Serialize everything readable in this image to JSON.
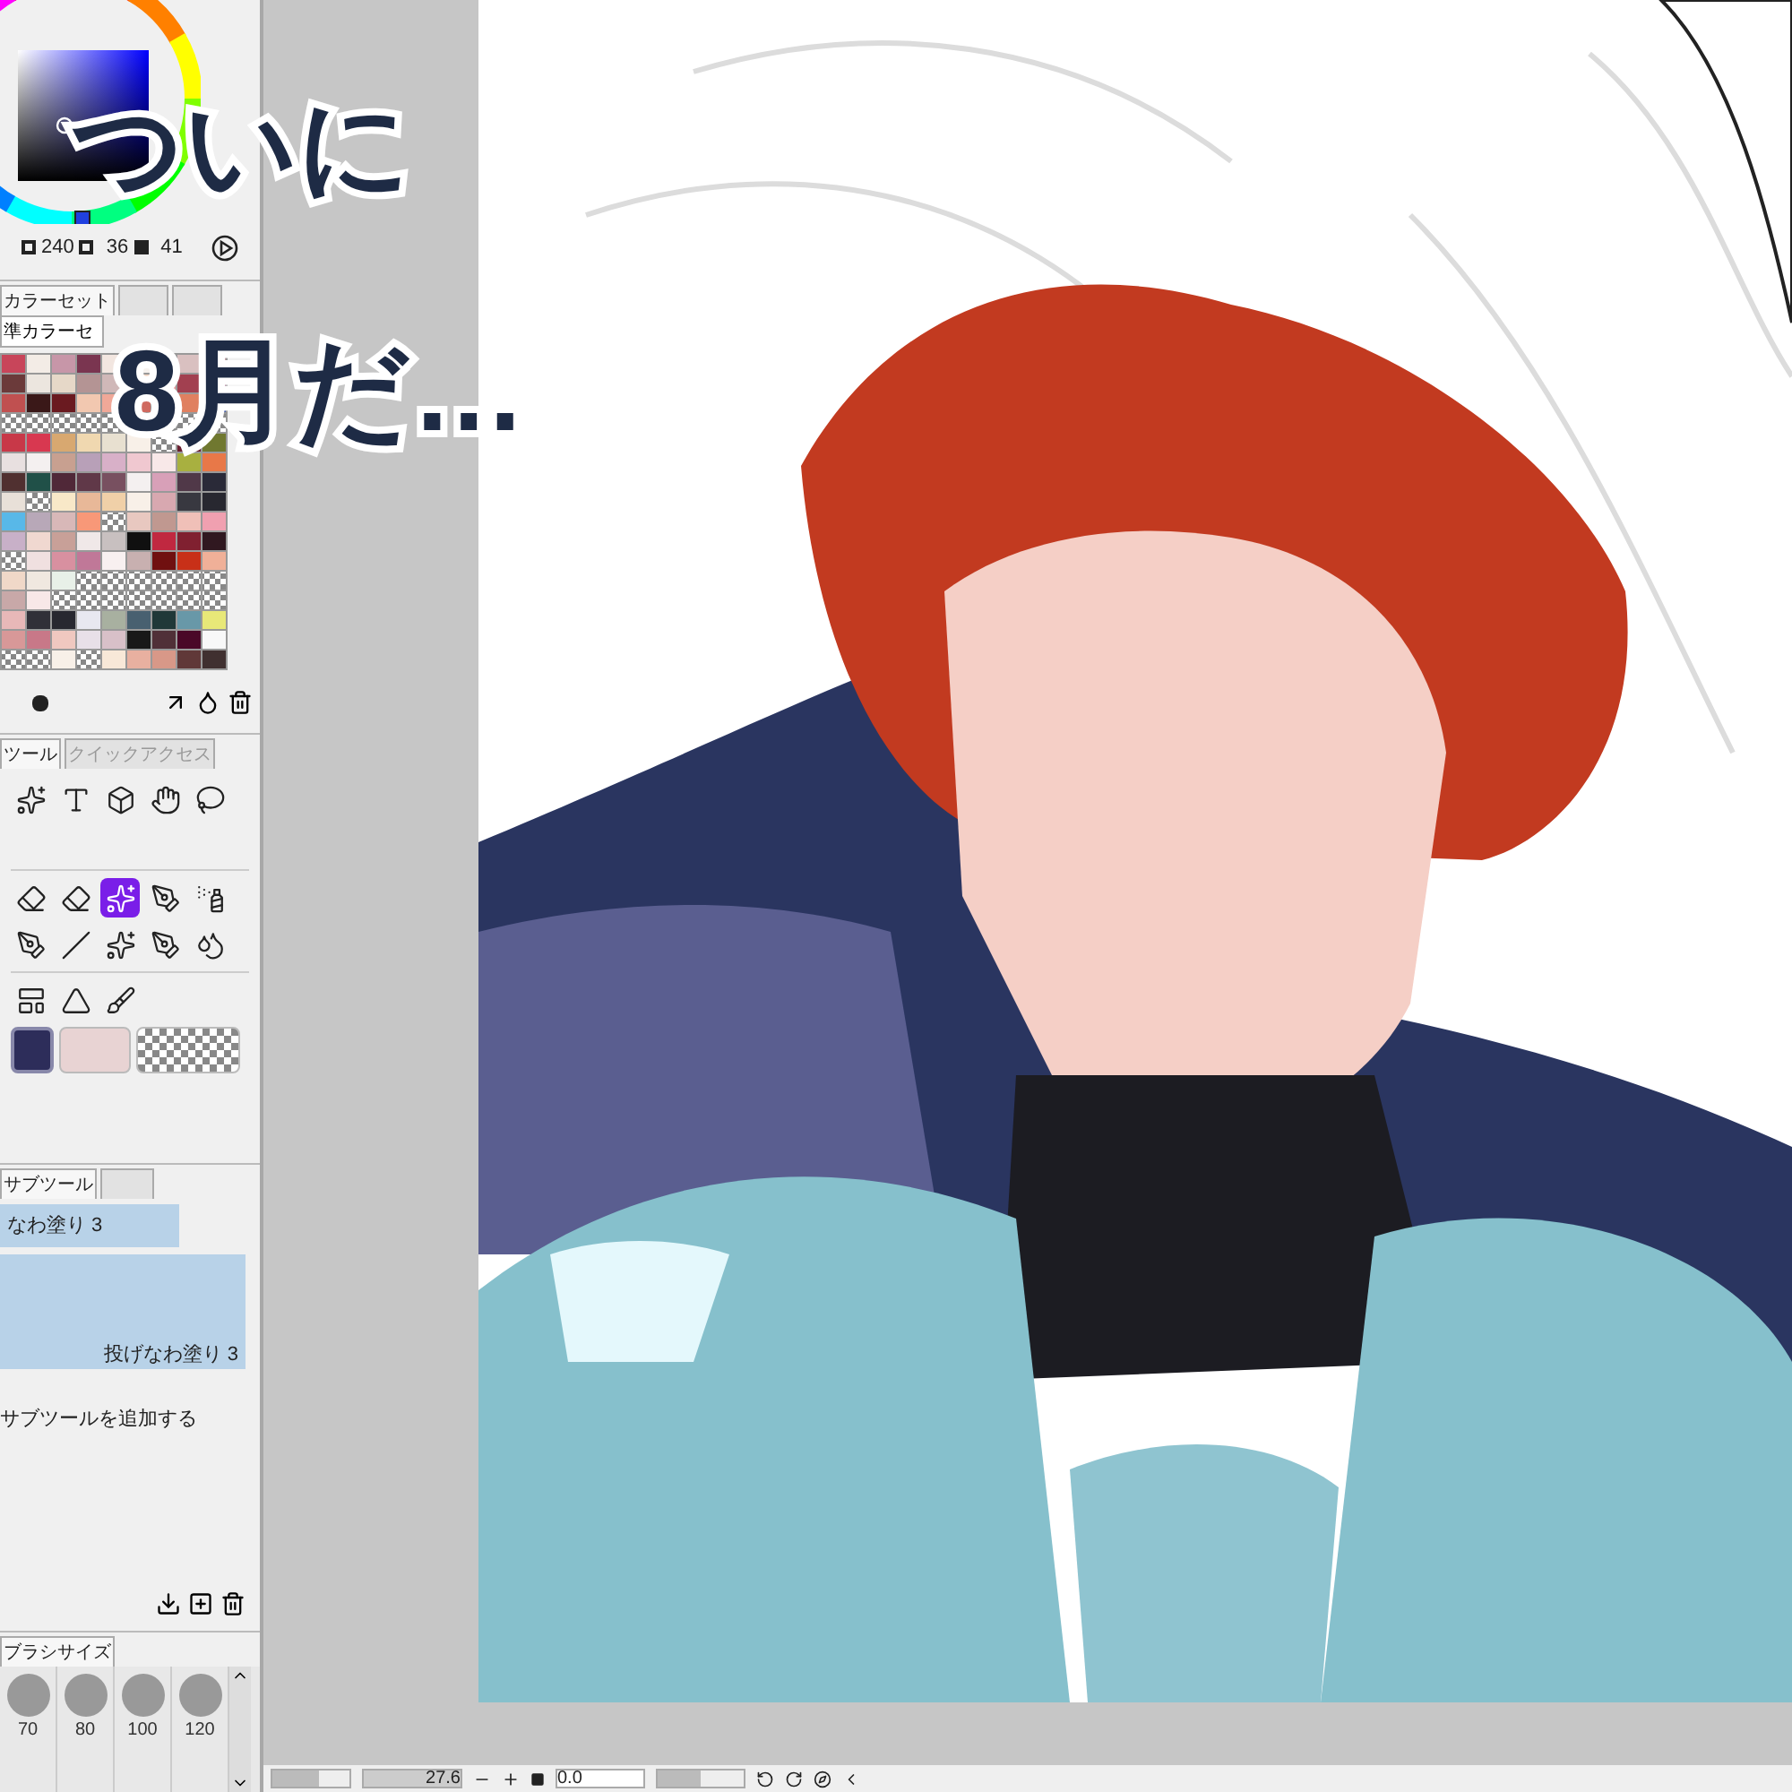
{
  "color_wheel": {
    "readings": [
      "240",
      "36",
      "41"
    ]
  },
  "color_set": {
    "tabs": [
      {
        "label": "カラーセット",
        "selected": true
      }
    ],
    "dropdown": "準カラーセ"
  },
  "tool_panel": {
    "tabs": [
      {
        "label": "ツール",
        "selected": true
      },
      {
        "label": "クイックアクセス",
        "selected": false
      }
    ]
  },
  "sub_tool": {
    "tabs": [
      {
        "label": "サブツール",
        "selected": true
      }
    ],
    "items": [
      {
        "label": "なわ塗り 3",
        "selected": true,
        "kind": "slim"
      },
      {
        "label": "投げなわ塗り 3",
        "selected": true,
        "kind": "large"
      }
    ],
    "add": "サブツールを追加する"
  },
  "brush_size": {
    "tab": "ブラシサイズ",
    "sizes": [
      "70",
      "80",
      "100",
      "120"
    ]
  },
  "status_bar": {
    "zoom_slider": {
      "level": 0.6
    },
    "zoom": "27.6",
    "angle": "0.0",
    "angle_slider": {
      "level": 0.5
    }
  },
  "handwriting": [
    "ついに",
    "8月だ…"
  ]
}
